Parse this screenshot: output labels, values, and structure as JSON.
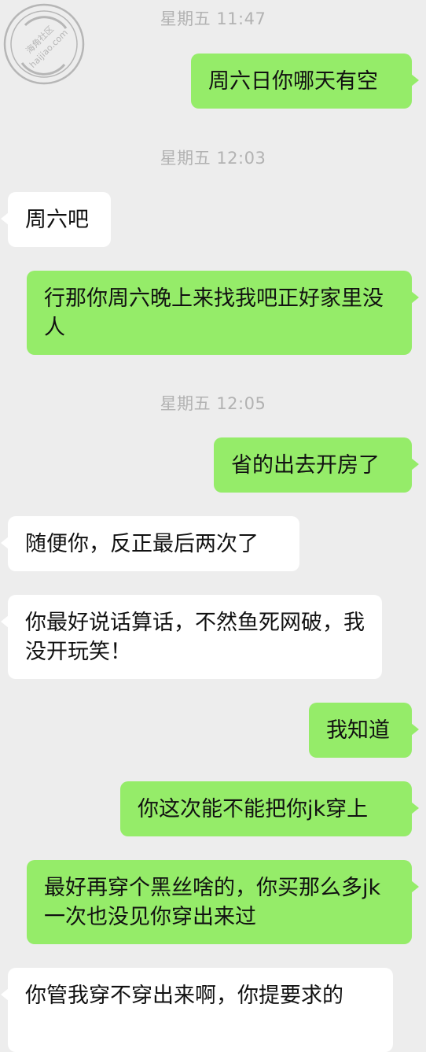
{
  "watermark": {
    "line1": "海角社区",
    "line2": "haijiao.com"
  },
  "messages": [
    {
      "kind": "time",
      "text": "星期五 11:47"
    },
    {
      "kind": "me",
      "text": "周六日你哪天有空"
    },
    {
      "kind": "time",
      "text": "星期五 12:03"
    },
    {
      "kind": "them",
      "text": "周六吧"
    },
    {
      "kind": "me",
      "text": "行那你周六晚上来找我吧正好家里没人"
    },
    {
      "kind": "time",
      "text": "星期五 12:05"
    },
    {
      "kind": "me",
      "text": "省的出去开房了"
    },
    {
      "kind": "them",
      "text": "随便你，反正最后两次了"
    },
    {
      "kind": "them",
      "text": "你最好说话算话，不然鱼死网破，我没开玩笑！"
    },
    {
      "kind": "me",
      "text": "我知道"
    },
    {
      "kind": "me",
      "text": "你这次能不能把你jk穿上"
    },
    {
      "kind": "me",
      "text": "最好再穿个黑丝啥的，你买那么多jk一次也没见你穿出来过"
    },
    {
      "kind": "them",
      "text": "你管我穿不穿出来啊，你提要求的"
    }
  ],
  "colors": {
    "background": "#ededed",
    "my_bubble": "#95ec69",
    "their_bubble": "#ffffff",
    "timestamp": "#b2b2b2"
  }
}
